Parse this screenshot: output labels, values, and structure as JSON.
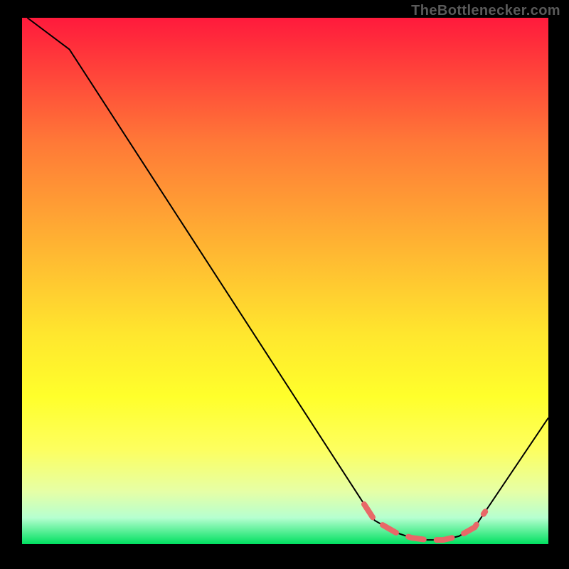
{
  "attribution": "TheBottlenecker.com",
  "chart_data": {
    "type": "line",
    "title": "",
    "xlabel": "",
    "ylabel": "",
    "xlim": [
      0,
      100
    ],
    "ylim": [
      0,
      100
    ],
    "x": [
      1,
      9,
      67,
      71,
      74,
      77,
      80,
      83,
      86,
      100
    ],
    "y": [
      100,
      94,
      4.5,
      2.2,
      1.2,
      0.8,
      0.8,
      1.5,
      3.2,
      24
    ],
    "highlight_range_x": [
      65,
      88
    ],
    "note": "Values read off a 0–100 plot grid; curve shows a steep linear fall from upper-left, a flat bottom around x≈70–85 (highlighted in coral dashes), then a rise toward the right edge."
  }
}
